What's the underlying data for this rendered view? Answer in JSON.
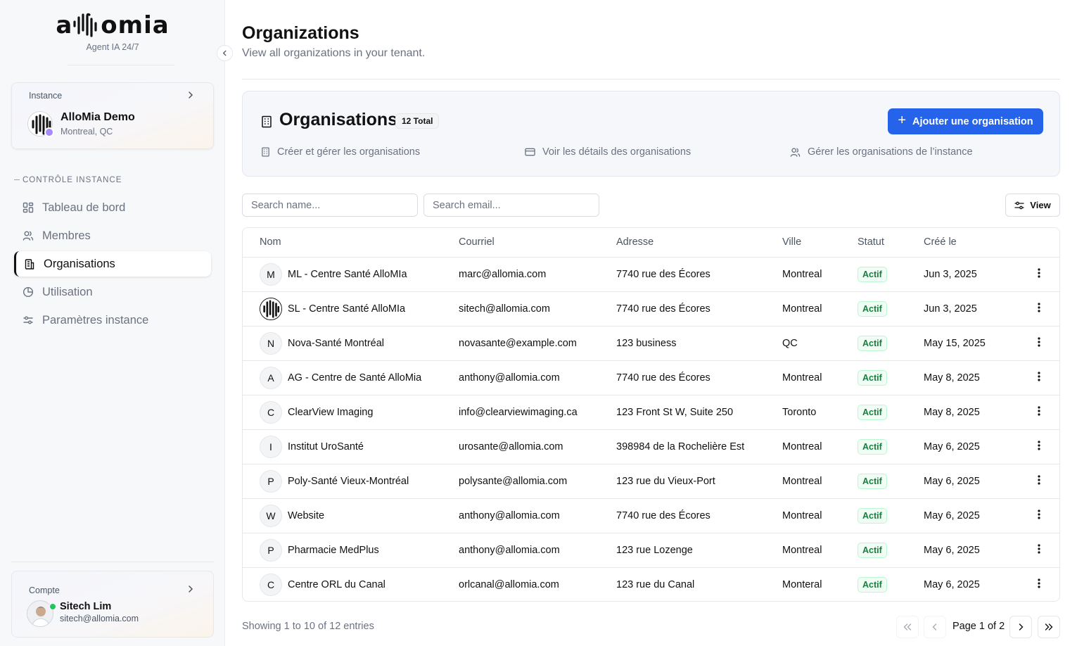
{
  "sidebar": {
    "brand": {
      "word_left": "a",
      "word_right": "omia",
      "tagline": "Agent IA 24/7"
    },
    "instance": {
      "label": "Instance",
      "name": "AlloMia Demo",
      "location": "Montreal, QC"
    },
    "section_title": "CONTRÔLE INSTANCE",
    "nav": [
      {
        "label": "Tableau de bord",
        "icon": "dashboard-icon"
      },
      {
        "label": "Membres",
        "icon": "users-icon"
      },
      {
        "label": "Organisations",
        "icon": "building-icon",
        "active": true
      },
      {
        "label": "Utilisation",
        "icon": "pie-chart-icon"
      },
      {
        "label": "Paramètres instance",
        "icon": "sliders-icon"
      }
    ],
    "account": {
      "label": "Compte",
      "name": "Sitech Lim",
      "email": "sitech@allomia.com",
      "status": "online"
    }
  },
  "header": {
    "title": "Organizations",
    "subtitle": "View all organizations in your tenant."
  },
  "org_panel": {
    "title": "Organisations",
    "total_badge": "12 Total",
    "add_button": "Ajouter une organisation",
    "features": [
      {
        "label": "Créer et gérer les organisations",
        "icon": "building-icon"
      },
      {
        "label": "Voir les détails des organisations",
        "icon": "card-icon"
      },
      {
        "label": "Gérer les organisations de l’instance",
        "icon": "users-icon"
      }
    ]
  },
  "filters": {
    "search_name_placeholder": "Search name...",
    "search_email_placeholder": "Search email...",
    "view_button": "View"
  },
  "table": {
    "columns": [
      "Nom",
      "Courriel",
      "Adresse",
      "Ville",
      "Statut",
      "Créé le"
    ],
    "rows": [
      {
        "initial": "M",
        "name": "ML - Centre Santé AlloMIa",
        "email": "marc@allomia.com",
        "address": "7740 rue des Écores",
        "city": "Montreal",
        "status": "Actif",
        "created": "Jun 3, 2025"
      },
      {
        "initial": "",
        "logo": true,
        "name": "SL - Centre Santé AlloMIa",
        "email": "sitech@allomia.com",
        "address": "7740 rue des Écores",
        "city": "Montreal",
        "status": "Actif",
        "created": "Jun 3, 2025"
      },
      {
        "initial": "N",
        "name": "Nova-Santé Montréal",
        "email": "novasante@example.com",
        "address": "123 business",
        "city": "QC",
        "status": "Actif",
        "created": "May 15, 2025"
      },
      {
        "initial": "A",
        "name": "AG - Centre de Santé AlloMia",
        "email": "anthony@allomia.com",
        "address": "7740 rue des Écores",
        "city": "Montreal",
        "status": "Actif",
        "created": "May 8, 2025"
      },
      {
        "initial": "C",
        "name": "ClearView Imaging",
        "email": "info@clearviewimaging.ca",
        "address": "123 Front St W, Suite 250",
        "city": "Toronto",
        "status": "Actif",
        "created": "May 8, 2025"
      },
      {
        "initial": "I",
        "name": "Institut UroSanté",
        "email": "urosante@allomia.com",
        "address": "398984 de la Rochelière Est",
        "city": "Montreal",
        "status": "Actif",
        "created": "May 6, 2025"
      },
      {
        "initial": "P",
        "name": "Poly-Santé Vieux-Montréal",
        "email": "polysante@allomia.com",
        "address": "123 rue du Vieux-Port",
        "city": "Montreal",
        "status": "Actif",
        "created": "May 6, 2025"
      },
      {
        "initial": "W",
        "name": "Website",
        "email": "anthony@allomia.com",
        "address": "7740 rue des Écores",
        "city": "Montreal",
        "status": "Actif",
        "created": "May 6, 2025"
      },
      {
        "initial": "P",
        "name": "Pharmacie MedPlus",
        "email": "anthony@allomia.com",
        "address": "123 rue Lozenge",
        "city": "Montreal",
        "status": "Actif",
        "created": "May 6, 2025"
      },
      {
        "initial": "C",
        "name": "Centre ORL du Canal",
        "email": "orlcanal@allomia.com",
        "address": "123 rue du Canal",
        "city": "Monteral",
        "status": "Actif",
        "created": "May 6, 2025"
      }
    ]
  },
  "pagination": {
    "showing": "Showing 1 to 10 of 12 entries",
    "page_label": "Page 1 of 2"
  },
  "colors": {
    "accent": "#2563eb",
    "status_green": "#15803d"
  }
}
